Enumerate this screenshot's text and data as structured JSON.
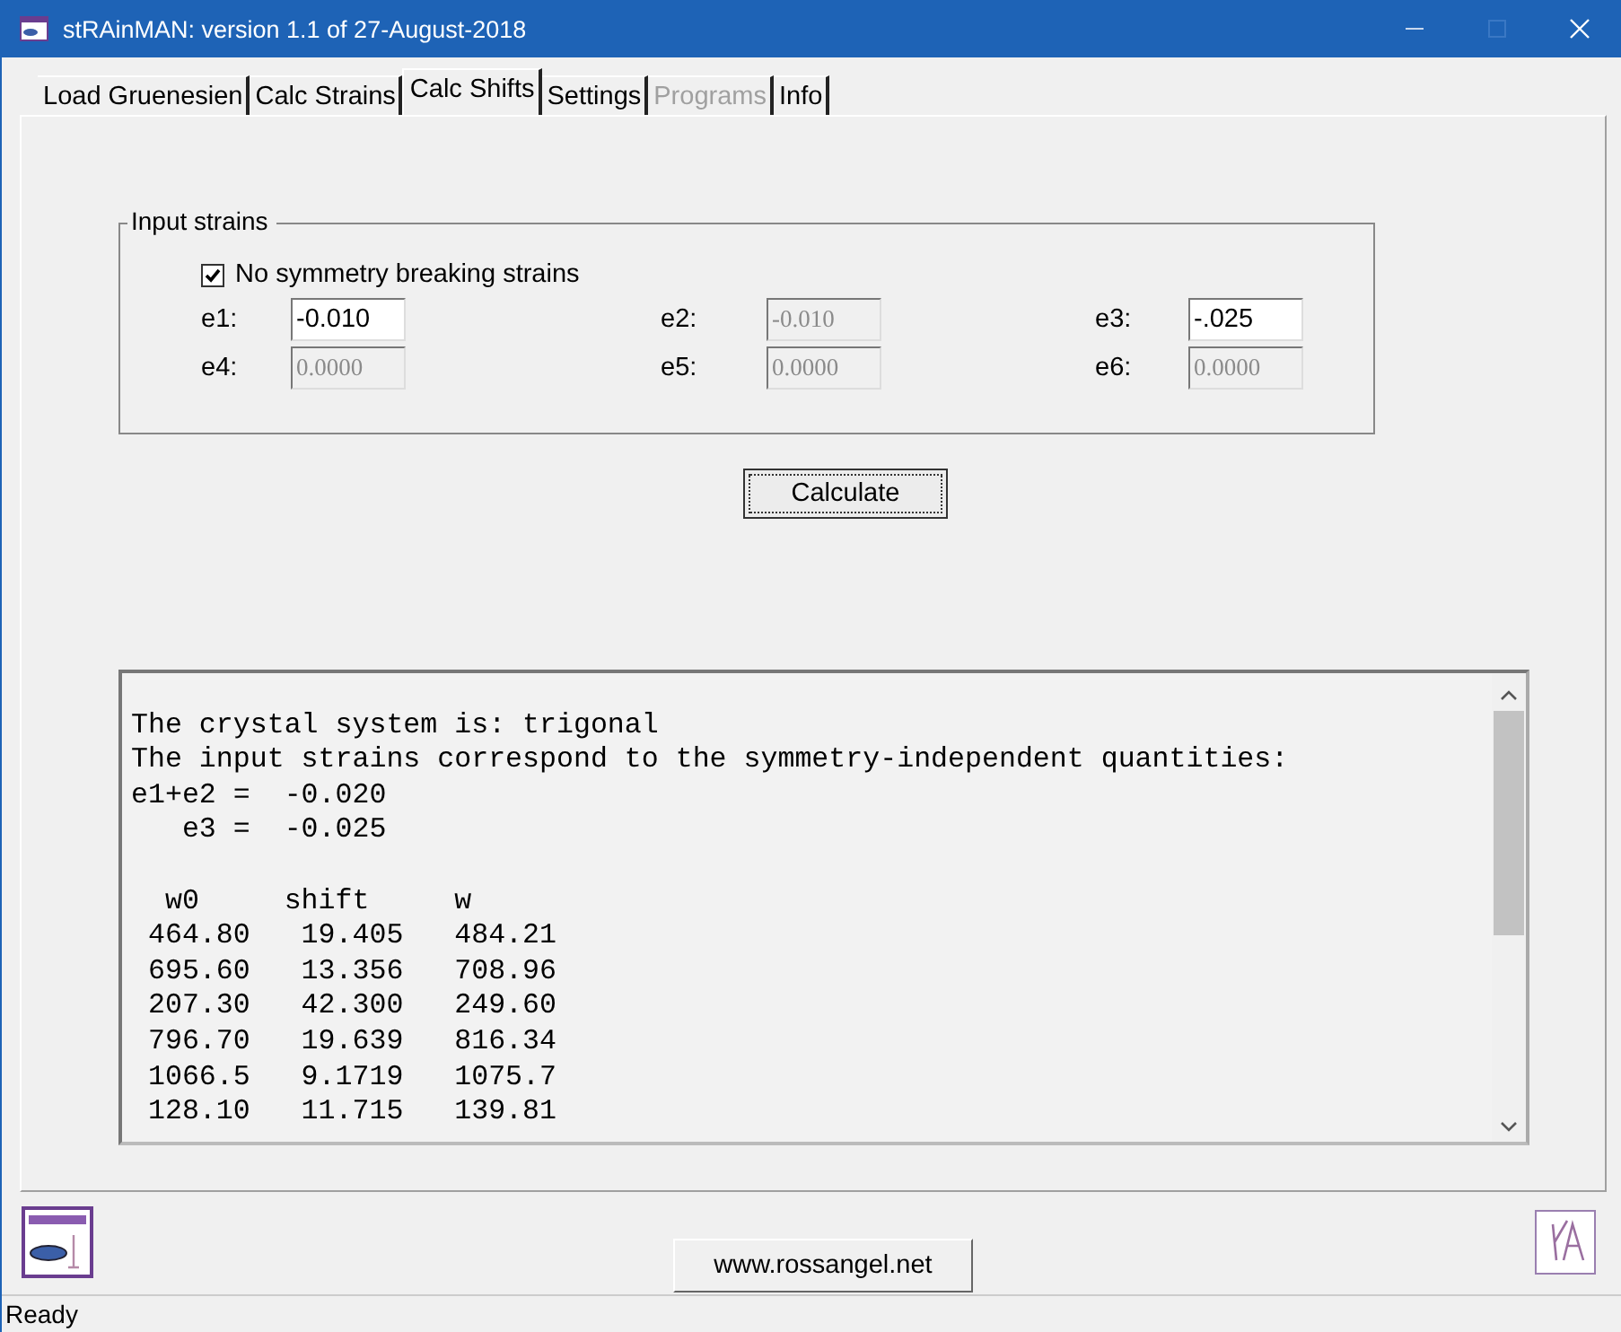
{
  "window": {
    "title": "stRAinMAN:  version  1.1 of 27-August-2018"
  },
  "tabs": [
    {
      "label": "Load Gruenesien",
      "selected": false,
      "disabled": false
    },
    {
      "label": "Calc Strains",
      "selected": false,
      "disabled": false
    },
    {
      "label": "Calc Shifts",
      "selected": true,
      "disabled": false
    },
    {
      "label": "Settings",
      "selected": false,
      "disabled": false
    },
    {
      "label": "Programs",
      "selected": false,
      "disabled": true
    },
    {
      "label": "Info",
      "selected": false,
      "disabled": false
    }
  ],
  "input_strains": {
    "title": "Input strains",
    "checkbox": {
      "label": "No symmetry breaking strains",
      "checked": true
    },
    "fields": [
      {
        "label": "e1:",
        "value": "-0.010",
        "disabled": false
      },
      {
        "label": "e2:",
        "value": "-0.010",
        "disabled": true
      },
      {
        "label": "e3:",
        "value": "-.025",
        "disabled": false
      },
      {
        "label": "e4:",
        "value": "0.0000",
        "disabled": true
      },
      {
        "label": "e5:",
        "value": "0.0000",
        "disabled": true
      },
      {
        "label": "e6:",
        "value": "0.0000",
        "disabled": true
      }
    ]
  },
  "calculate_button": "Calculate",
  "output_blocks": [
    [
      "The crystal system is: trigonal",
      "The input strains correspond to the symmetry-independent quantities:",
      "e1+e2 =  -0.020",
      "   e3 =  -0.025"
    ],
    [
      "  w0     shift     w",
      " 464.80   19.405   484.21",
      " 695.60   13.356   708.96",
      " 207.30   42.300   249.60",
      " 796.70   19.639   816.34",
      " 1066.5   9.1719   1075.7",
      " 128.10   11.715   139.81"
    ]
  ],
  "link_button": "www.rossangel.net",
  "status_bar": "Ready"
}
